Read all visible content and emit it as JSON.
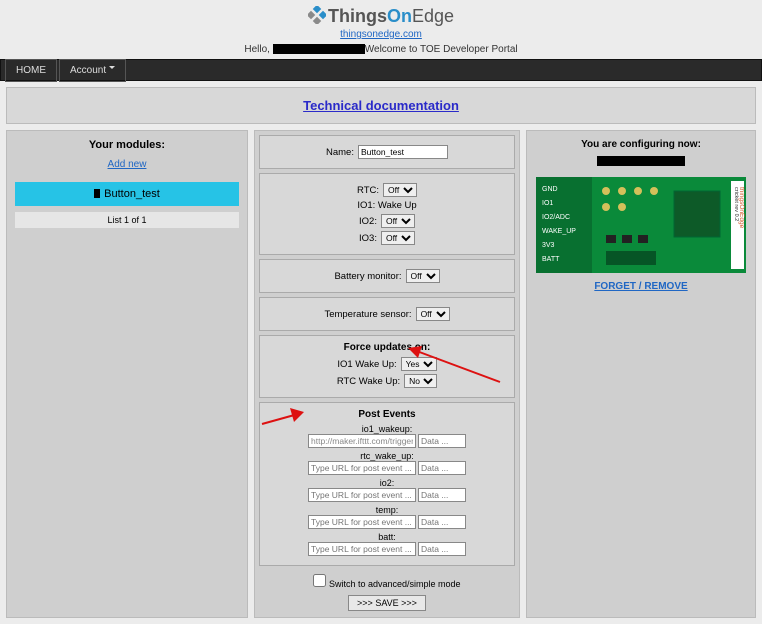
{
  "header": {
    "logo_a": "Things",
    "logo_b": "On",
    "logo_c": "Edge",
    "site": "thingsonedge.com",
    "hello_pre": "Hello, ",
    "hello_post": "Welcome to TOE Developer Portal"
  },
  "nav": {
    "home": "HOME",
    "account": "Account"
  },
  "tech": {
    "label": "Technical documentation"
  },
  "modules": {
    "title": "Your modules:",
    "addnew": "Add new",
    "selected": "Button_test",
    "listinfo": "List 1 of 1"
  },
  "cfg": {
    "name_lbl": "Name:",
    "name_val": "Button_test",
    "rtc_lbl": "RTC:",
    "rtc_val": "Off",
    "io1_lbl": "IO1: Wake Up",
    "io2_lbl": "IO2:",
    "io2_val": "Off",
    "io3_lbl": "IO3:",
    "io3_val": "Off",
    "batt_lbl": "Battery monitor:",
    "batt_val": "Off",
    "temp_lbl": "Temperature sensor:",
    "temp_val": "Off",
    "force_title": "Force updates on:",
    "io1w_lbl": "IO1 Wake Up:",
    "io1w_val": "Yes",
    "rtcw_lbl": "RTC Wake Up:",
    "rtcw_val": "No",
    "events_title": "Post Events",
    "ev": [
      {
        "name": "io1_wakeup:",
        "url": "http://maker.ifttt.com/trigger/b",
        "data": "Data ..."
      },
      {
        "name": "rtc_wake_up:",
        "url": "Type URL for post event ...",
        "data": "Data ..."
      },
      {
        "name": "io2:",
        "url": "Type URL for post event ...",
        "data": "Data ..."
      },
      {
        "name": "temp:",
        "url": "Type URL for post event ...",
        "data": "Data ..."
      },
      {
        "name": "batt:",
        "url": "Type URL for post event ...",
        "data": "Data ..."
      }
    ],
    "switch": "Switch to advanced/simple mode",
    "save": ">>> SAVE >>>"
  },
  "right": {
    "title": "You are configuring now:",
    "forget": "FORGET / REMOVE",
    "pins": [
      "GND",
      "IO1",
      "IO2/ADC",
      "WAKE_UP",
      "3V3",
      "BATT"
    ],
    "brand": "thingsOnEdge",
    "model": "cricket rev 0.2"
  }
}
